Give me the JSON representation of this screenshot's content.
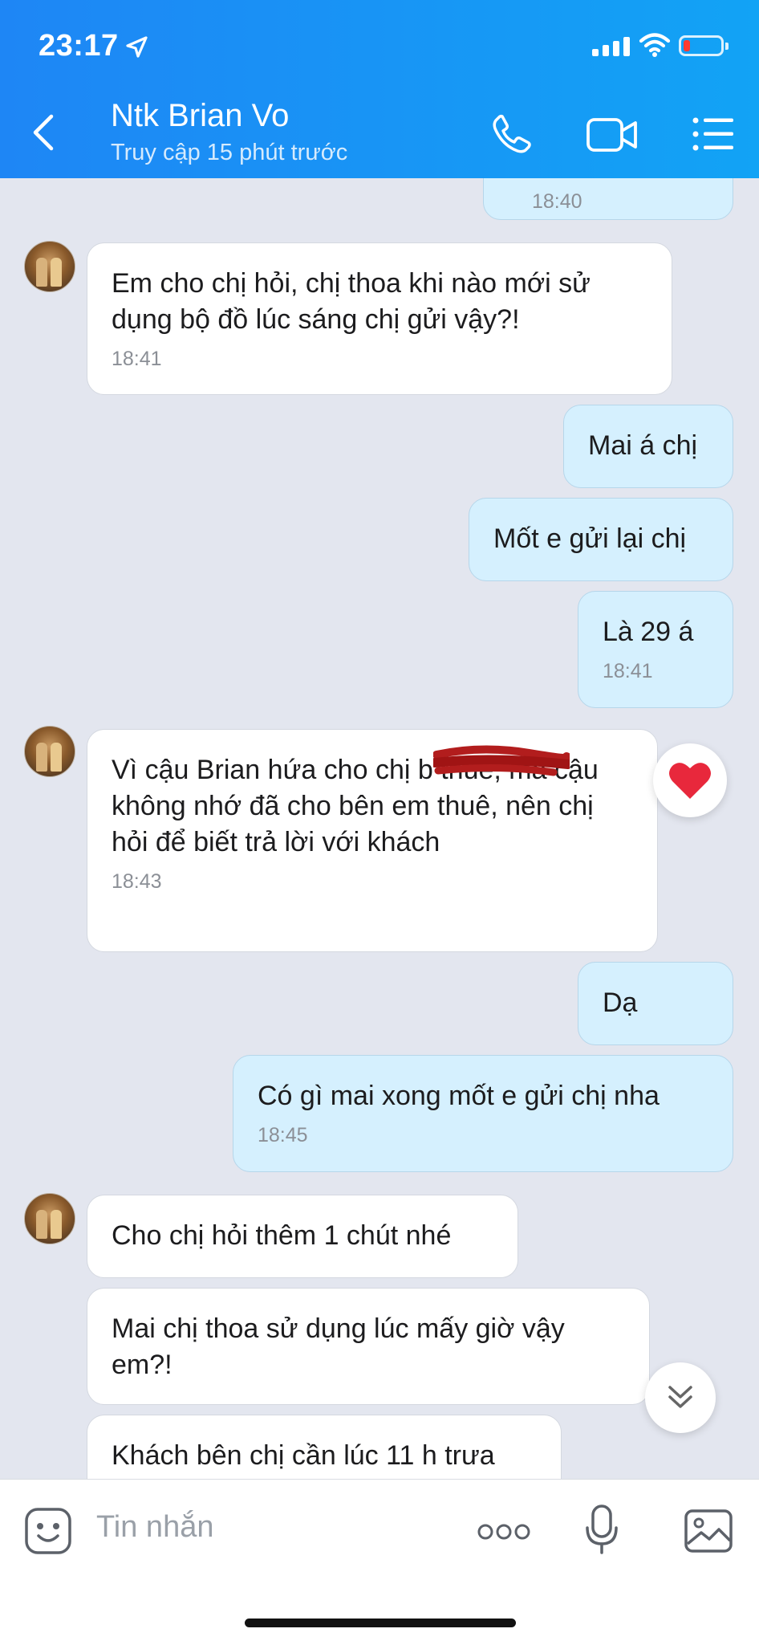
{
  "status_bar": {
    "time": "23:17"
  },
  "header": {
    "contact_name": "Ntk Brian Vo",
    "last_seen": "Truy cập 15 phút trước",
    "icons": [
      "back-chevron-icon",
      "phone-icon",
      "video-call-icon",
      "menu-list-icon"
    ]
  },
  "messages": [
    {
      "side": "out",
      "text": "",
      "time": "18:40"
    },
    {
      "side": "in",
      "text": "Em cho chị hỏi, chị thoa khi nào mới sử dụng bộ đồ lúc sáng chị gửi vậy?!",
      "time": "18:41"
    },
    {
      "side": "out",
      "text": "Mai á chị",
      "time": ""
    },
    {
      "side": "out",
      "text": "Mốt e gửi lại chị",
      "time": ""
    },
    {
      "side": "out",
      "text": "Là 29 á",
      "time": "18:41"
    },
    {
      "side": "in",
      "text": "Vì cậu Brian hứa cho chị b thuê, mà cậu không nhớ đã cho bên em thuê, nên chị hỏi để biết trả lời với khách",
      "time": "18:43",
      "reaction": "heart"
    },
    {
      "side": "out",
      "text": "Dạ",
      "time": ""
    },
    {
      "side": "out",
      "text": "Có gì mai xong mốt e gửi chị nha",
      "time": "18:45"
    },
    {
      "side": "in",
      "text": "Cho chị hỏi thêm 1 chút nhé",
      "time": ""
    },
    {
      "side": "in",
      "text": "Mai chị thoa sử dụng lúc mấy giờ vậy em?!",
      "time": ""
    },
    {
      "side": "in",
      "text": "Khách bên chị cần lúc 11 h trưa",
      "time": ""
    }
  ],
  "input_bar": {
    "placeholder": "Tin nhắn",
    "icons": [
      "sticker-icon",
      "more-dots-icon",
      "microphone-icon",
      "gallery-icon"
    ]
  },
  "colors": {
    "header_start": "#1e86f5",
    "header_end": "#12a3f5",
    "outgoing_bubble": "#d5f0fe",
    "incoming_bubble": "#ffffff",
    "chat_background": "#e3e6ef"
  }
}
